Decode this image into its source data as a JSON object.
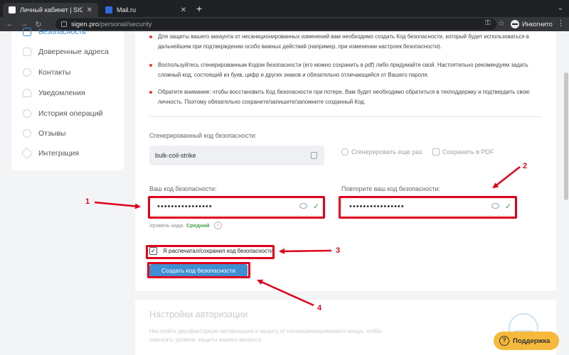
{
  "browser": {
    "tabs": [
      {
        "label": "Личный кабинет | SIGEN.pro",
        "active": true
      },
      {
        "label": "Mail.ru",
        "active": false
      }
    ],
    "url_host": "sigen.pro",
    "url_path": "/personal/security",
    "profile": "Инкогнито"
  },
  "sidebar": {
    "items": [
      {
        "label": "Безопасность"
      },
      {
        "label": "Доверенные адреса"
      },
      {
        "label": "Контакты"
      },
      {
        "label": "Уведомления"
      },
      {
        "label": "История операций"
      },
      {
        "label": "Отзывы"
      },
      {
        "label": "Интеграция"
      }
    ]
  },
  "security": {
    "bullets": [
      "Для защиты вашего аккаунта от несанкционированных изменений вам необходимо создать Код безопасности, который будет использоваться в дальнейшем при подтверждении особо важных действий (например, при изменении настроек безопасности).",
      "Воспользуйтесь сгенерированным Кодом безопасности (его можно сохранить в pdf) либо придумайте свой. Настоятельно рекомендуем задать сложный код, состоящий из букв, цифр и других знаков и обязательно отличающийся от Вашего пароля.",
      "Обратите внимание: чтобы восстановить Код безопасности при потере, Вам будет необходимо обратиться в техподдержку и подтвердить свою личность. Поэтому обязательно сохраните/запишите/запомните созданный Код."
    ],
    "generated_label": "Сгенерированный код безопасности:",
    "generated_code": "bulk-coil-strike",
    "regenerate_label": "Сгенерировать еще раз",
    "save_pdf_label": "Сохранить в PDF",
    "code_label": "Ваш код безопасности:",
    "code_value": "••••••••••••••••",
    "repeat_label": "Повторите ваш код безопасности:",
    "repeat_value": "••••••••••••••••",
    "level_label": "Уровень кода:",
    "level_value": "Средний",
    "checkbox_label": "Я распечатал/сохранил код безопасности",
    "checkbox_mark": "✓",
    "submit_label": "Создать код безопасности"
  },
  "auth": {
    "title": "Настройки авторизации",
    "desc": "Настройте двухфакторную авторизацию и защиту от несанкционированного входа, чтобы повысить уровень защиты вашего аккаунта"
  },
  "support": {
    "label": "Поддержка"
  },
  "annotations": {
    "numbers": [
      "1",
      "2",
      "3",
      "4"
    ],
    "color": "#e0001b"
  },
  "colors": {
    "accent": "#3f8fd2",
    "success": "#43a047",
    "support": "#f6b93b"
  }
}
